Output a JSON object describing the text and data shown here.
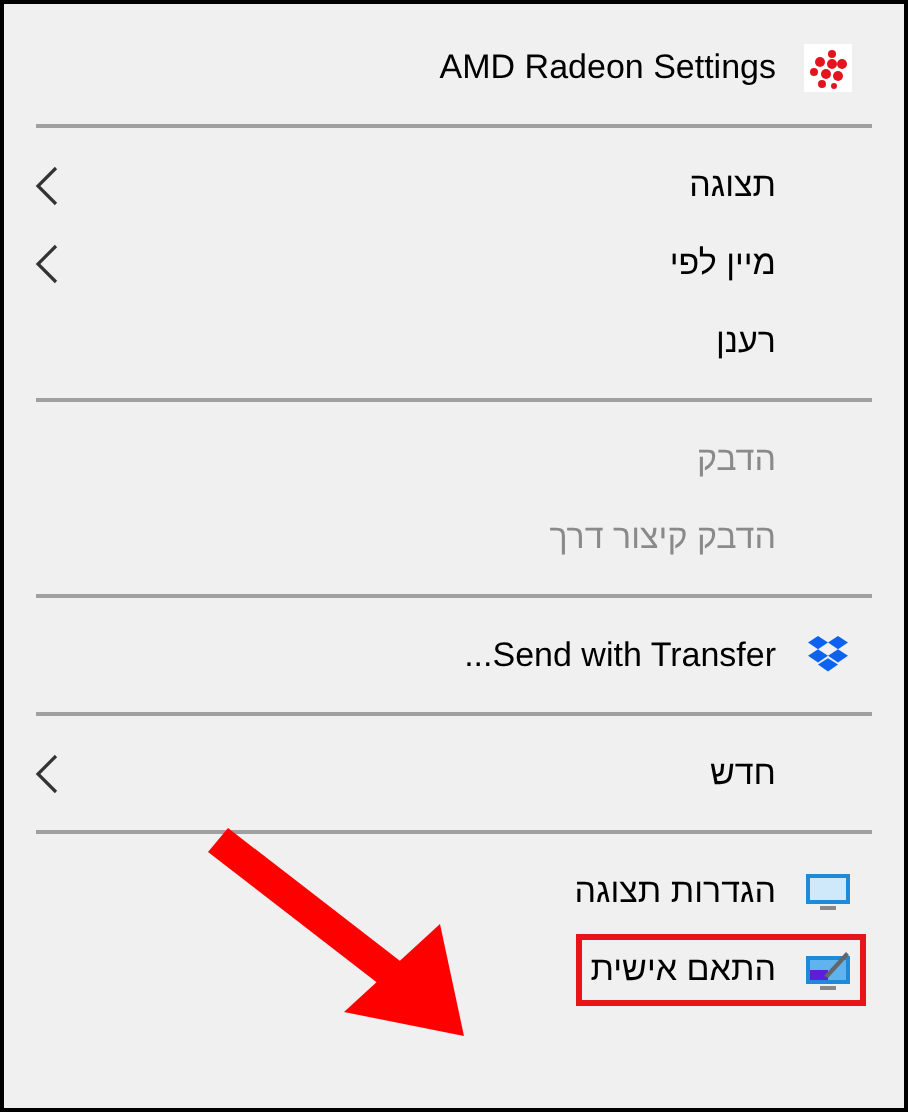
{
  "menu": {
    "items": [
      {
        "kind": "amd",
        "label": "AMD Radeon Settings",
        "disabled": false,
        "submenu": false,
        "highlighted": false
      },
      {
        "kind": "separator"
      },
      {
        "kind": "plain",
        "label": "תצוגה",
        "disabled": false,
        "submenu": true,
        "highlighted": false
      },
      {
        "kind": "plain",
        "label": "מיין לפי",
        "disabled": false,
        "submenu": true,
        "highlighted": false
      },
      {
        "kind": "plain",
        "label": "רענן",
        "disabled": false,
        "submenu": false,
        "highlighted": false
      },
      {
        "kind": "separator"
      },
      {
        "kind": "plain",
        "label": "הדבק",
        "disabled": true,
        "submenu": false,
        "highlighted": false
      },
      {
        "kind": "plain",
        "label": "הדבק קיצור דרך",
        "disabled": true,
        "submenu": false,
        "highlighted": false
      },
      {
        "kind": "separator"
      },
      {
        "kind": "share",
        "label": "Send with Transfer...",
        "disabled": false,
        "submenu": false,
        "highlighted": false
      },
      {
        "kind": "separator"
      },
      {
        "kind": "plain",
        "label": "חדש",
        "disabled": false,
        "submenu": true,
        "highlighted": false
      },
      {
        "kind": "separator"
      },
      {
        "kind": "display",
        "label": "הגדרות תצוגה",
        "disabled": false,
        "submenu": false,
        "highlighted": false
      },
      {
        "kind": "personalize",
        "label": "התאם אישית",
        "disabled": false,
        "submenu": false,
        "highlighted": true
      }
    ]
  }
}
